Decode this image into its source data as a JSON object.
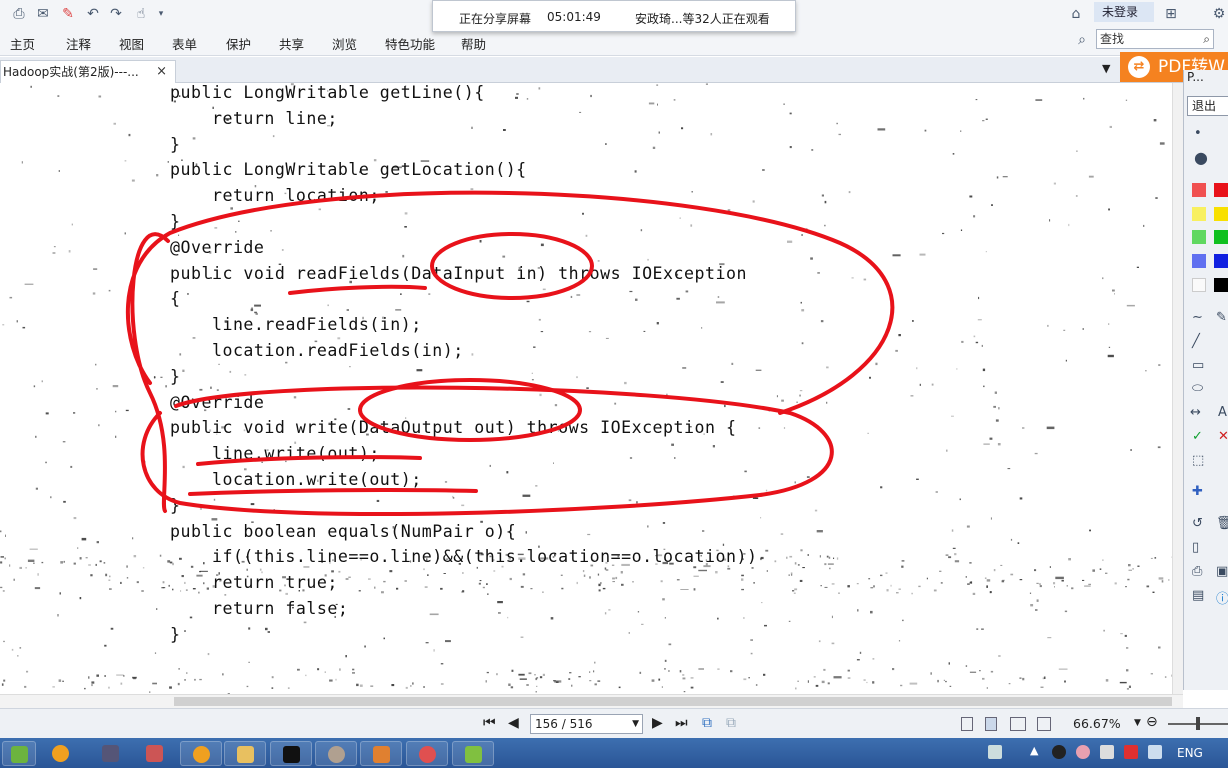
{
  "menubar": {
    "items": [
      "主页",
      "注释",
      "视图",
      "表单",
      "保护",
      "共享",
      "浏览",
      "特色功能",
      "帮助"
    ]
  },
  "share_banner": {
    "status": "正在分享屏幕",
    "time": "05:01:49",
    "viewers": "安政琦...等32人正在观看"
  },
  "account": {
    "login_label": "未登录"
  },
  "search": {
    "value": "查找"
  },
  "tab": {
    "title": "Hadoop实战(第2版)---...",
    "close": "×"
  },
  "pdf_banner": {
    "label": "PDF转W"
  },
  "code": {
    "lines": [
      "public LongWritable getLine(){",
      "    return line;",
      "}",
      "public LongWritable getLocation(){",
      "    return location;",
      "}",
      "@Override",
      "public void readFields(DataInput in) throws IOException",
      "{",
      "    line.readFields(in);",
      "    location.readFields(in);",
      "}",
      "@Override",
      "public void write(DataOutput out) throws IOException {",
      "    line.write(out);",
      "    location.write(out);",
      "}",
      "public boolean equals(NumPair o){",
      "    if((this.line==o.line)&&(this.location==o.location))",
      "    return true;",
      "    return false;",
      "}"
    ]
  },
  "pen_panel": {
    "title": "P...",
    "exit_label": "退出"
  },
  "status": {
    "page": "156 / 516",
    "zoom": "66.67%"
  },
  "tray": {
    "language": "ENG"
  },
  "colors": {
    "annotation": "#e8121a",
    "accent_orange": "#f58220",
    "taskbar": "#2f5d9e"
  },
  "icons": [
    "print-icon",
    "mail-icon",
    "new-icon",
    "undo-icon",
    "redo-icon",
    "hand-icon",
    "skin-icon",
    "magnifier-icon"
  ]
}
